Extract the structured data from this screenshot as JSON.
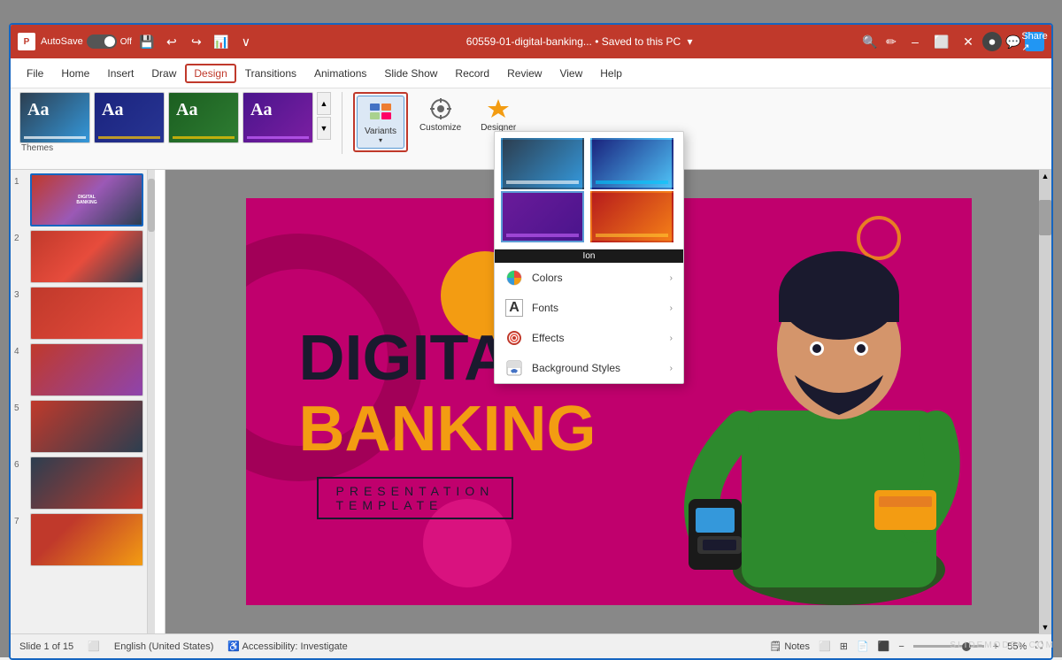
{
  "window": {
    "title": "60559-01-digital-banking... • Saved to this PC",
    "title_short": "60559-01-digital-banking...",
    "saved_status": "Saved to this PC",
    "app_icon": "P",
    "autosave_label": "AutoSave",
    "autosave_state": "Off"
  },
  "title_bar": {
    "buttons": {
      "minimize": "–",
      "restore": "⬜",
      "close": "✕"
    }
  },
  "menu": {
    "items": [
      "File",
      "Home",
      "Insert",
      "Draw",
      "Design",
      "Transitions",
      "Animations",
      "Slide Show",
      "Record",
      "Review",
      "View",
      "Help"
    ],
    "active": "Design"
  },
  "ribbon": {
    "themes_label": "Themes",
    "themes": [
      {
        "label": "Aa",
        "style": "default"
      },
      {
        "label": "Aa",
        "style": "blue-pattern"
      },
      {
        "label": "Aa",
        "style": "green"
      },
      {
        "label": "Aa",
        "style": "purple"
      }
    ],
    "buttons": [
      {
        "label": "Variants",
        "active": true
      },
      {
        "label": "Customize",
        "active": false
      },
      {
        "label": "Designer",
        "active": false
      }
    ]
  },
  "variants_dropdown": {
    "thumbnails": [
      {
        "style": "vt1",
        "tooltip": ""
      },
      {
        "style": "vt2",
        "tooltip": ""
      },
      {
        "style": "vt3",
        "tooltip": "Ion"
      },
      {
        "style": "vt4",
        "tooltip": ""
      }
    ],
    "tooltip_text": "Ion",
    "menu_items": [
      {
        "label": "Colors",
        "icon": "🎨"
      },
      {
        "label": "Fonts",
        "icon": "A"
      },
      {
        "label": "Effects",
        "icon": "✨"
      },
      {
        "label": "Background Styles",
        "icon": "🖼"
      }
    ]
  },
  "slides": [
    {
      "num": 1,
      "style": "s1",
      "text": "DIGITAL BANKING",
      "selected": true
    },
    {
      "num": 2,
      "style": "s2",
      "text": ""
    },
    {
      "num": 3,
      "style": "s3",
      "text": ""
    },
    {
      "num": 4,
      "style": "s4",
      "text": ""
    },
    {
      "num": 5,
      "style": "s5",
      "text": ""
    },
    {
      "num": 6,
      "style": "s6",
      "text": ""
    },
    {
      "num": 7,
      "style": "s7",
      "text": ""
    }
  ],
  "slide_content": {
    "title_line1": "DIGITA",
    "title_line2": "BANKING",
    "subtitle_line1": "PRESENTATION",
    "subtitle_line2": "TEMPLATE"
  },
  "status_bar": {
    "slide_info": "Slide 1 of 15",
    "language": "English (United States)",
    "accessibility": "Accessibility: Investigate",
    "notes_label": "Notes",
    "zoom_level": "55%"
  },
  "icons": {
    "search": "🔍",
    "share": "↗",
    "undo": "↩",
    "redo": "↪",
    "save": "💾",
    "more": "⋯",
    "chevron_down": "▾",
    "chevron_right": "›",
    "comments": "💬",
    "record_btn": "⏺",
    "notes_icon": "🗒",
    "scroll_up": "▲",
    "scroll_down": "▼"
  }
}
